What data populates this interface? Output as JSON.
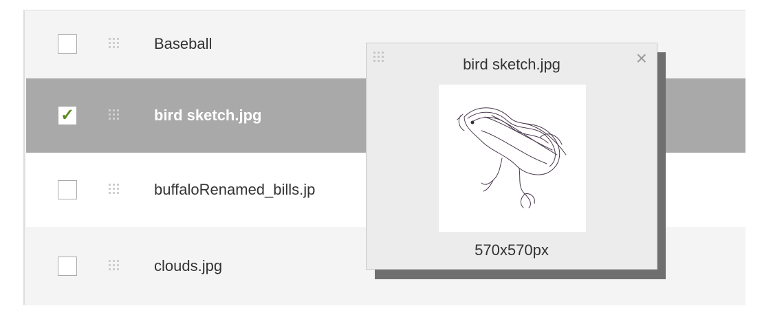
{
  "items": [
    {
      "label": "Baseball",
      "checked": false
    },
    {
      "label": "bird sketch.jpg",
      "checked": true
    },
    {
      "label": "buffaloRenamed_bills.jp",
      "checked": false
    },
    {
      "label": "clouds.jpg",
      "checked": false
    }
  ],
  "popup": {
    "title": "bird sketch.jpg",
    "close_icon": "×",
    "dimensions": "570x570px"
  },
  "colors": {
    "selected_row": "#a9a9a9",
    "check": "#5b8c24"
  }
}
